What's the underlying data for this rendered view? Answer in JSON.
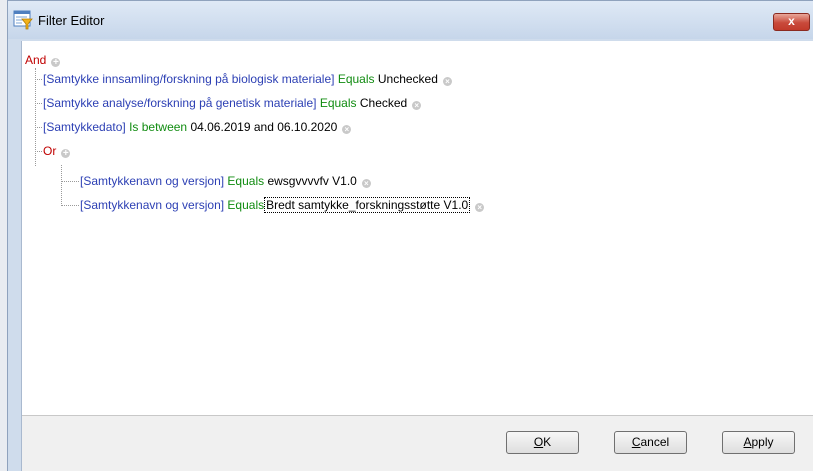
{
  "window": {
    "title": "Filter Editor",
    "close_label": "x"
  },
  "tree": {
    "root_group": {
      "operator": "And"
    },
    "conditions": [
      {
        "field": "[Samtykke innsamling/forskning på biologisk materiale]",
        "operator": "Equals",
        "value": "Unchecked"
      },
      {
        "field": "[Samtykke analyse/forskning på genetisk materiale]",
        "operator": "Equals",
        "value": "Checked"
      },
      {
        "field": "[Samtykkedato]",
        "operator": "Is between",
        "value1": "04.06.2019",
        "joiner": "and",
        "value2": "06.10.2020"
      }
    ],
    "sub_group": {
      "operator": "Or",
      "conditions": [
        {
          "field": "[Samtykkenavn og versjon]",
          "operator": "Equals",
          "value": "ewsgvvvvfv V1.0"
        },
        {
          "field": "[Samtykkenavn og versjon]",
          "operator": "Equals",
          "value": "Bredt samtykke_forskningsstøtte V1.0"
        }
      ]
    }
  },
  "buttons": {
    "ok": {
      "accel": "O",
      "rest": "K"
    },
    "cancel": {
      "accel": "C",
      "rest": "ancel"
    },
    "apply": {
      "accel": "A",
      "rest": "pply"
    }
  },
  "colors": {
    "group_operator": "#c00000",
    "field": "#2d40b4",
    "condition_operator": "#118c11",
    "value": "#000000"
  },
  "icons": [
    "filter-editor-icon",
    "close-icon",
    "add-condition-icon",
    "remove-condition-icon"
  ]
}
